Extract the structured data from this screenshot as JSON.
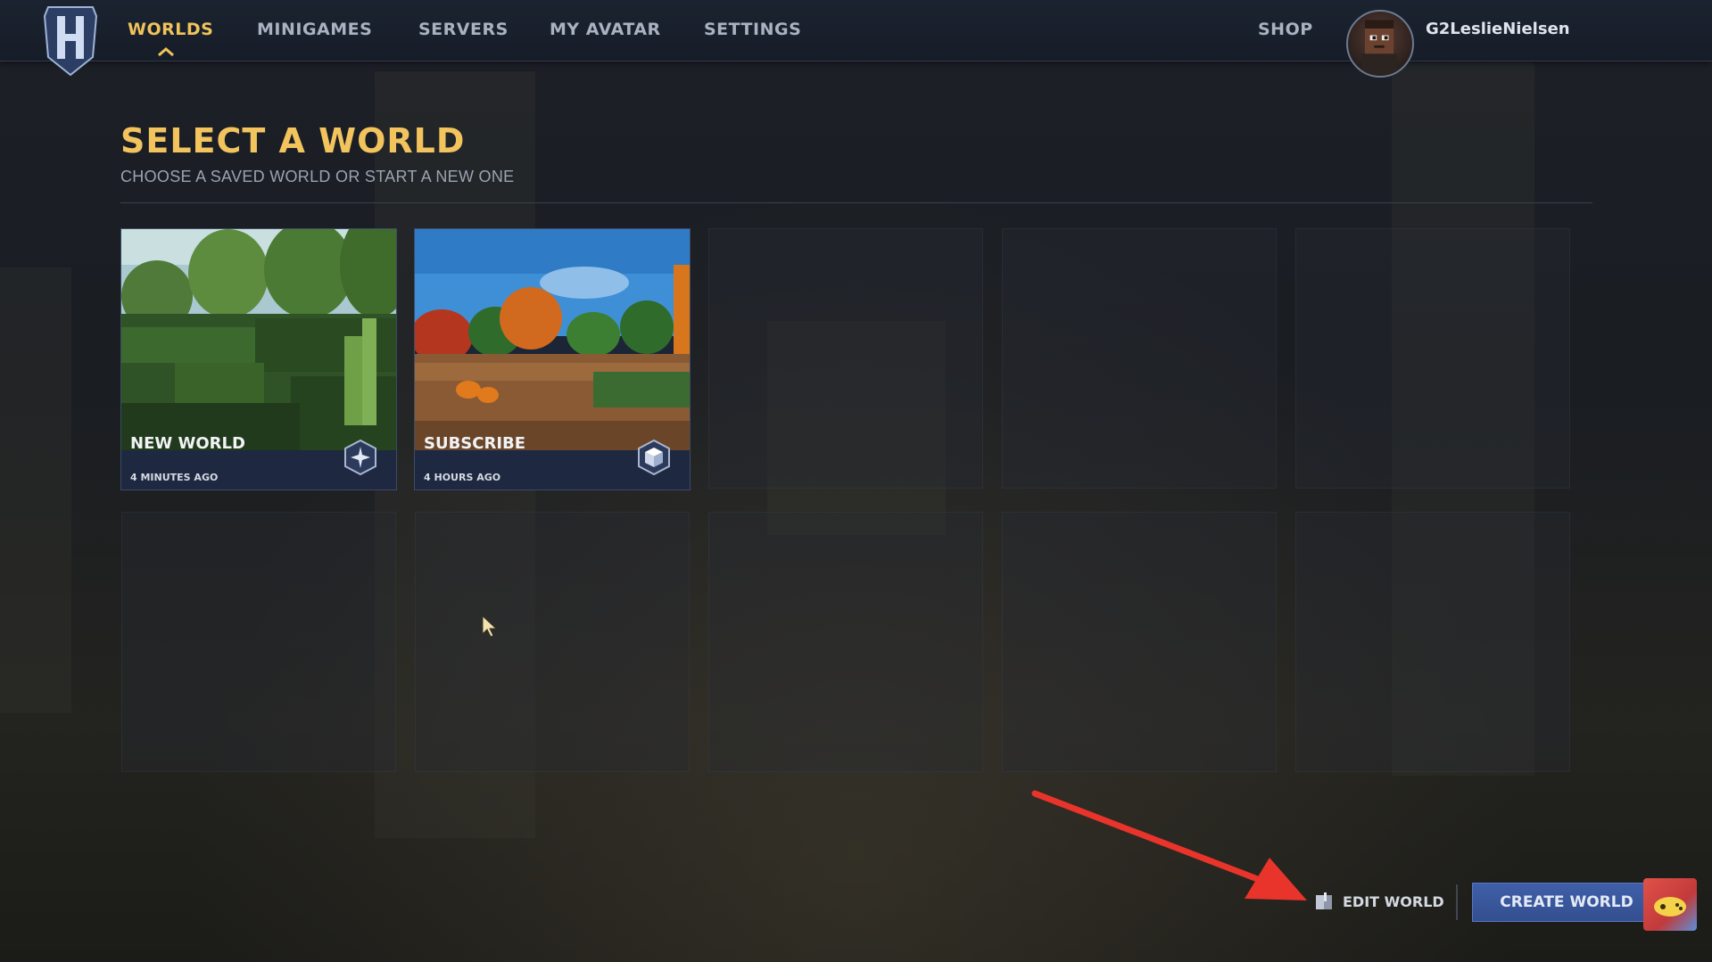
{
  "nav": {
    "items": [
      {
        "label": "WORLDS",
        "active": true
      },
      {
        "label": "MINIGAMES",
        "active": false
      },
      {
        "label": "SERVERS",
        "active": false
      },
      {
        "label": "MY AVATAR",
        "active": false
      },
      {
        "label": "SETTINGS",
        "active": false
      }
    ],
    "shop_label": "SHOP",
    "username": "G2LeslieNielsen",
    "logo_icon": "hytale-h-logo-icon"
  },
  "page": {
    "title": "SELECT A WORLD",
    "subtitle": "CHOOSE A SAVED WORLD OR START A NEW ONE"
  },
  "worlds": [
    {
      "name": "NEW WORLD",
      "time": "4 MINUTES AGO",
      "mode_icon": "creative-mode-icon"
    },
    {
      "name": "SUBSCRIBE",
      "time": "4 HOURS AGO",
      "mode_icon": "cube-mode-icon"
    }
  ],
  "actions": {
    "edit_label": "EDIT WORLD",
    "create_label": "CREATE WORLD"
  },
  "colors": {
    "accent_gold": "#f3c45e",
    "button_blue": "#3f5fa8",
    "annotation_red": "#e8342a"
  }
}
